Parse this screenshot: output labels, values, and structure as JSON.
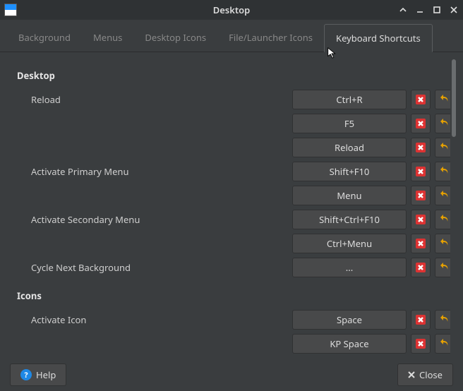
{
  "window": {
    "title": "Desktop"
  },
  "tabs": [
    {
      "label": "Background"
    },
    {
      "label": "Menus"
    },
    {
      "label": "Desktop Icons"
    },
    {
      "label": "File/Launcher Icons"
    },
    {
      "label": "Keyboard Shortcuts"
    }
  ],
  "sections": {
    "desktop": {
      "header": "Desktop"
    },
    "icons": {
      "header": "Icons"
    }
  },
  "shortcuts": {
    "reload": {
      "label": "Reload",
      "bindings": [
        "Ctrl+R",
        "F5",
        "Reload"
      ]
    },
    "activate_primary_menu": {
      "label": "Activate Primary Menu",
      "bindings": [
        "Shift+F10",
        "Menu"
      ]
    },
    "activate_secondary_menu": {
      "label": "Activate Secondary Menu",
      "bindings": [
        "Shift+Ctrl+F10",
        "Ctrl+Menu"
      ]
    },
    "cycle_next_background": {
      "label": "Cycle Next Background",
      "bindings": [
        "..."
      ]
    },
    "activate_icon": {
      "label": "Activate Icon",
      "bindings": [
        "Space",
        "KP Space"
      ]
    }
  },
  "footer": {
    "help": "Help",
    "close": "Close"
  }
}
